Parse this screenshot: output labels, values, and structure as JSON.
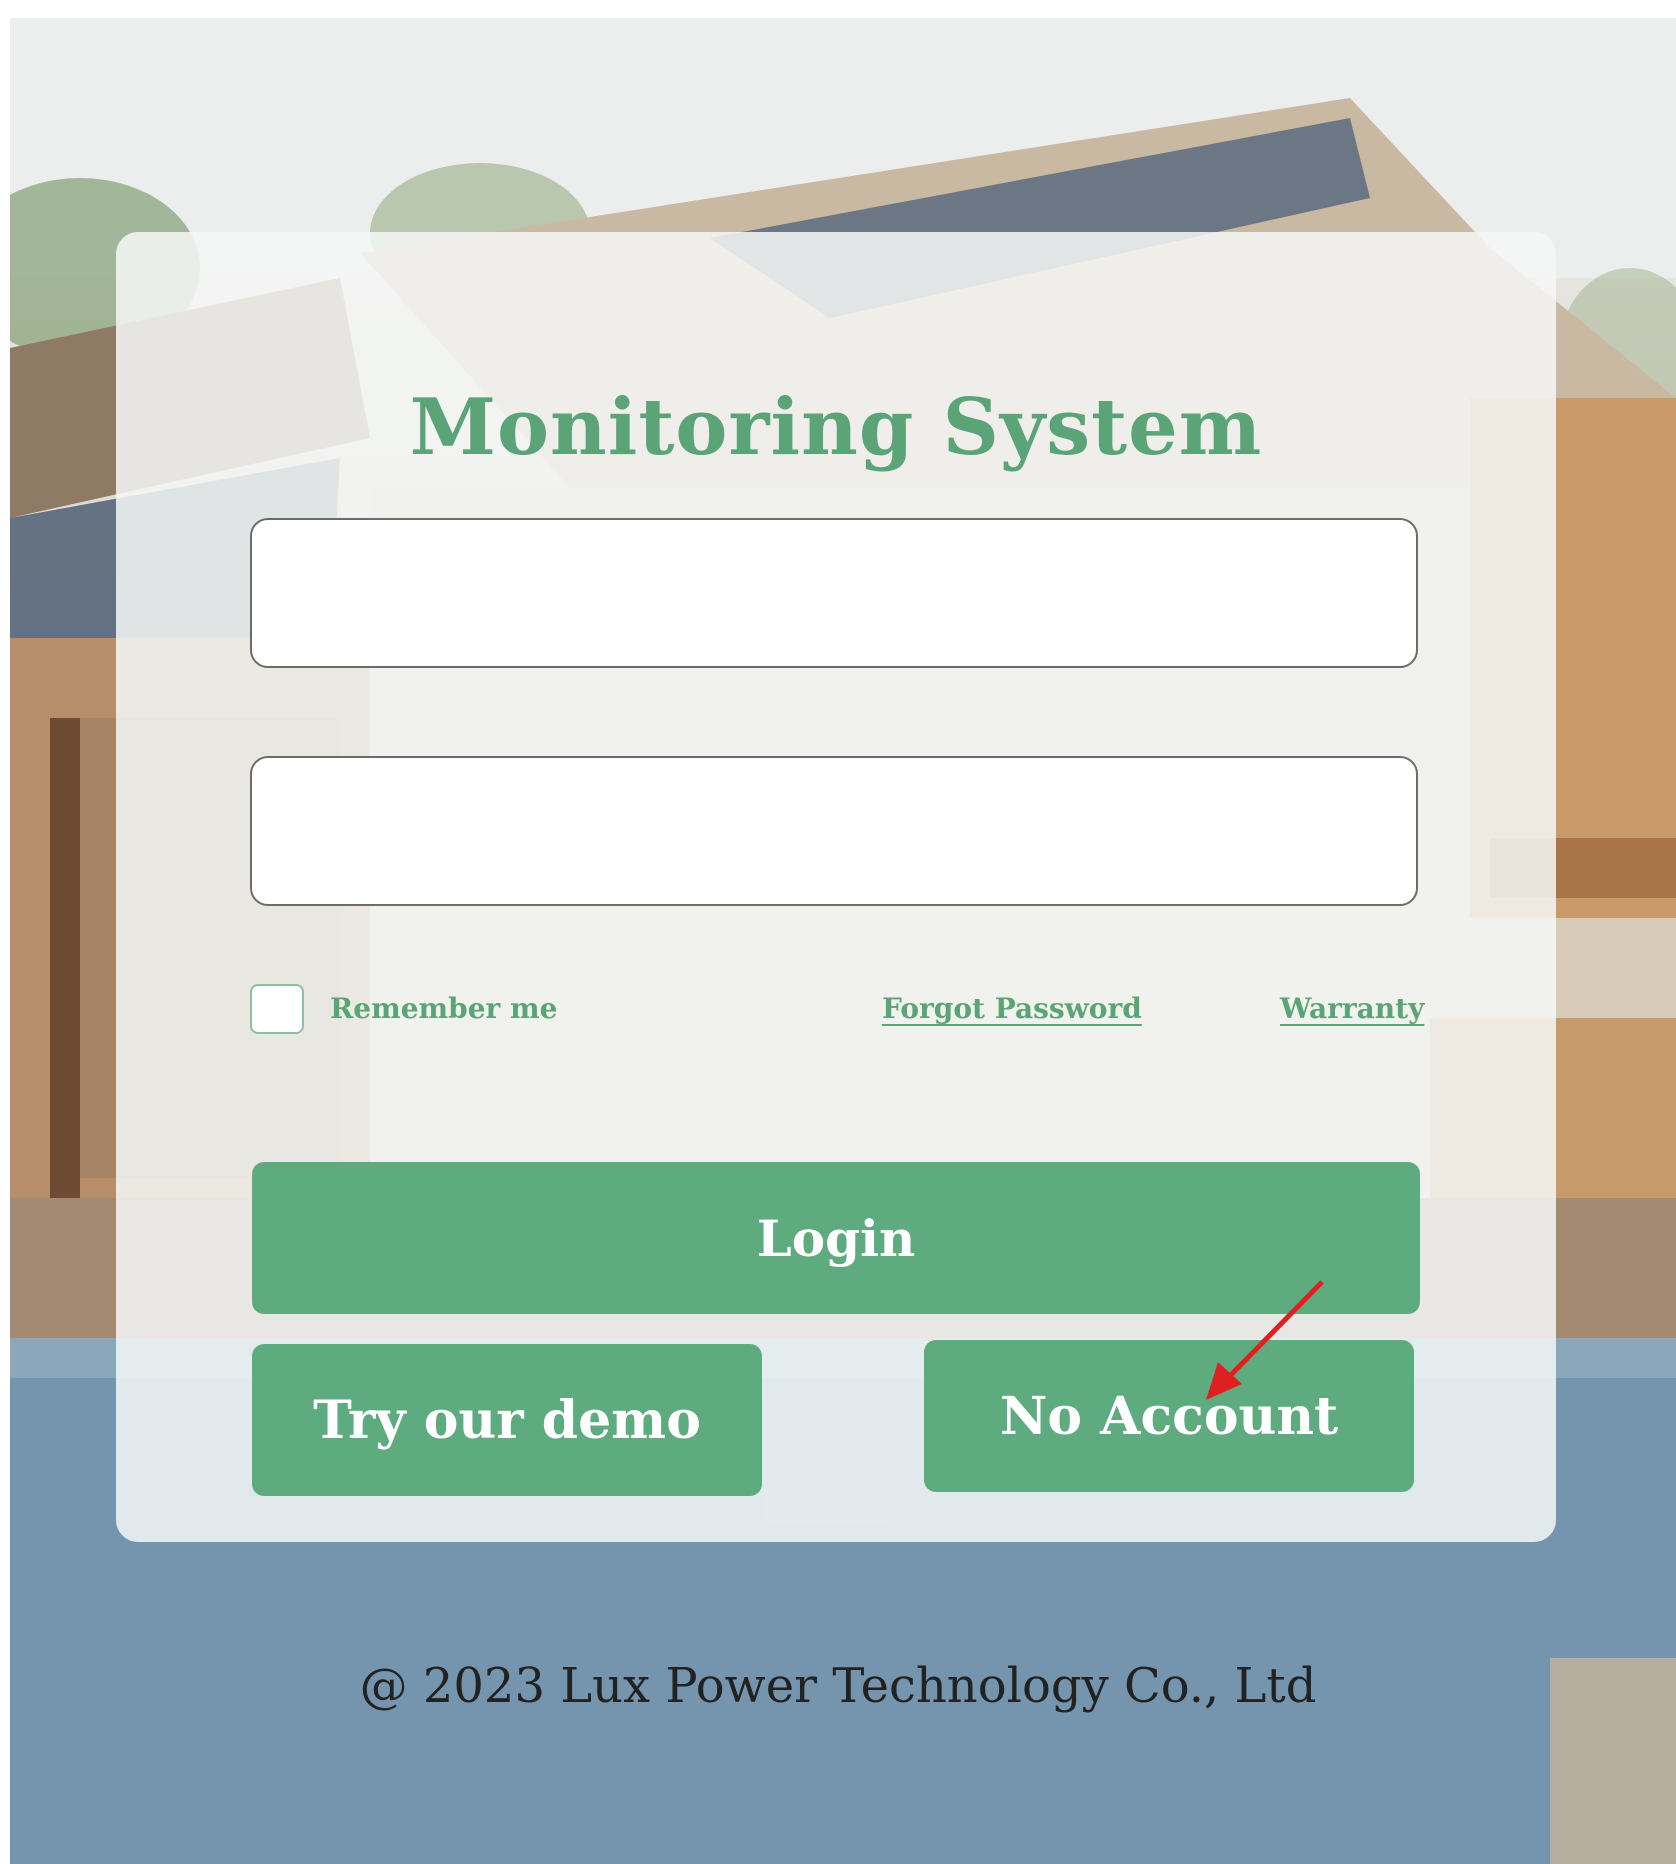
{
  "app": {
    "title": "Monitoring System"
  },
  "form": {
    "username": {
      "value": "",
      "placeholder": ""
    },
    "password": {
      "value": "",
      "placeholder": ""
    },
    "remember_label": "Remember me",
    "remember_checked": false,
    "forgot_password_label": "Forgot Password",
    "warranty_label": "Warranty"
  },
  "buttons": {
    "login_label": "Login",
    "demo_label": "Try our demo",
    "no_account_label": "No Account"
  },
  "footer": {
    "copyright": "@ 2023 Lux Power Technology Co., Ltd"
  },
  "colors": {
    "accent": "#5fab80",
    "title": "#5aa477",
    "annotation_arrow": "#e02020"
  },
  "annotation": {
    "type": "arrow",
    "points_to": "no-account-button"
  }
}
